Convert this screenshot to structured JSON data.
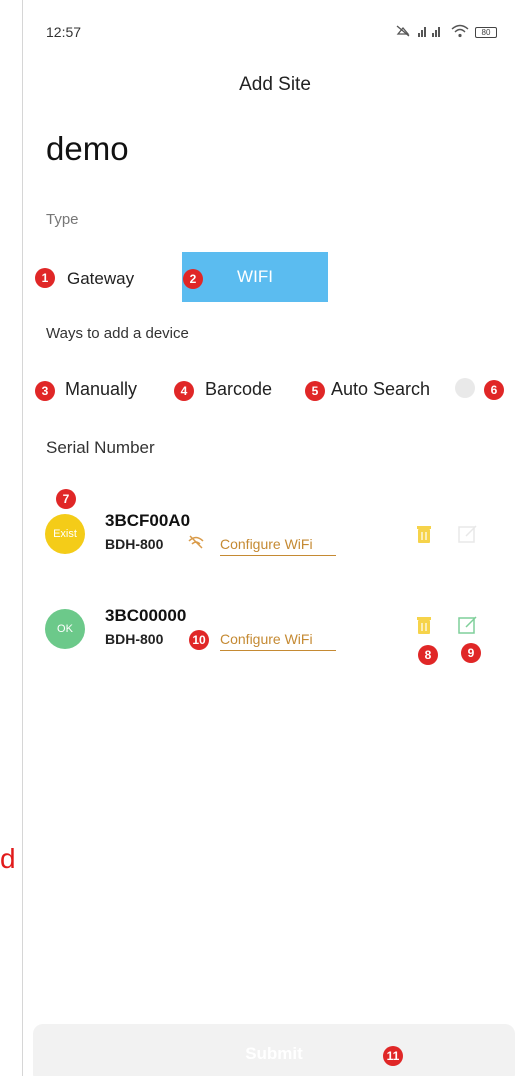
{
  "status_bar": {
    "time": "12:57",
    "battery": "80"
  },
  "header": {
    "title": "Add Site"
  },
  "site": {
    "name": "demo"
  },
  "type_section": {
    "label": "Type",
    "options": [
      {
        "label": "Gateway"
      },
      {
        "label": "WIFI"
      }
    ]
  },
  "ways_section": {
    "label": "Ways to add a device",
    "options": [
      {
        "label": "Manually"
      },
      {
        "label": "Barcode"
      },
      {
        "label": "Auto Search"
      }
    ]
  },
  "serial_section": {
    "label": "Serial Number"
  },
  "devices": [
    {
      "serial": "3BCF00A0",
      "model": "BDH-800",
      "status": "Exist",
      "action": "Configure WiFi"
    },
    {
      "serial": "3BC00000",
      "model": "BDH-800",
      "status": "OK",
      "action": "Configure WiFi"
    }
  ],
  "submit": {
    "label": "Submit"
  },
  "annotations": [
    "1",
    "2",
    "3",
    "4",
    "5",
    "6",
    "7",
    "8",
    "9",
    "10",
    "11"
  ],
  "side_marker": "d",
  "colors": {
    "accent": "#5bbcf0",
    "badge": "#e02727",
    "exist": "#f4cc18",
    "ok": "#6cc98a",
    "configure": "#c58a33"
  }
}
